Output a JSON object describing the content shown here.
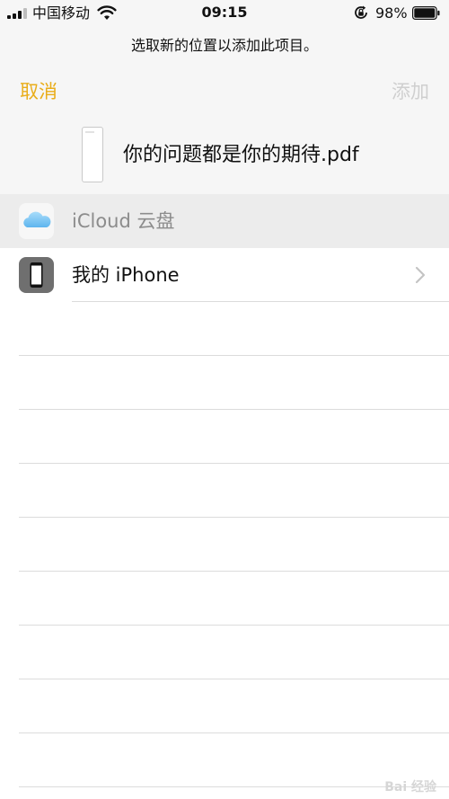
{
  "status_bar": {
    "carrier": "中国移动",
    "time": "09:15",
    "battery_percent": "98%"
  },
  "picker": {
    "prompt": "选取新的位置以添加此项目。",
    "cancel_label": "取消",
    "add_label": "添加",
    "file_name": "你的问题都是你的期待.pdf"
  },
  "locations": [
    {
      "label": "iCloud 云盘",
      "icon": "icloud-icon",
      "enabled": false
    },
    {
      "label": "我的 iPhone",
      "icon": "iphone-icon",
      "enabled": true
    }
  ],
  "watermark": "Bai 经验",
  "colors": {
    "accent": "#e9ad1a",
    "disabled_text": "#cfcfcf",
    "icloud_blue": "#7cc4f2"
  }
}
